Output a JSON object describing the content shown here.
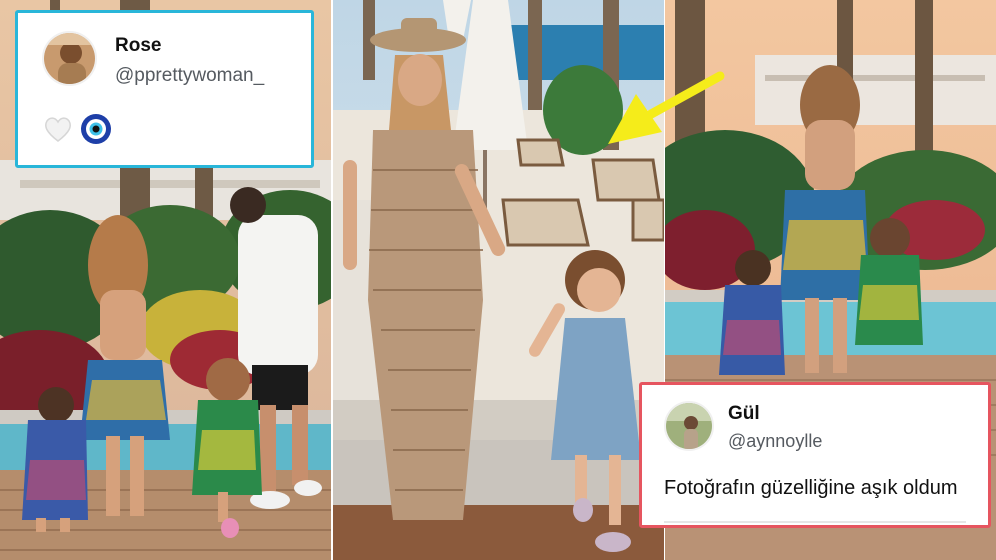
{
  "tweets": {
    "rose": {
      "display_name": "Rose",
      "handle": "@pprettywoman_",
      "reactions": [
        "white-heart-icon",
        "nazar-amulet-icon"
      ]
    },
    "gul": {
      "display_name": "Gül",
      "handle": "@aynnoylle",
      "text": "Fotoğrafın güzelliğine aşık oldum"
    }
  },
  "colors": {
    "rose_card_border": "#29b6d9",
    "gul_card_border": "#e6555f",
    "arrow": "#f5ec1a"
  }
}
